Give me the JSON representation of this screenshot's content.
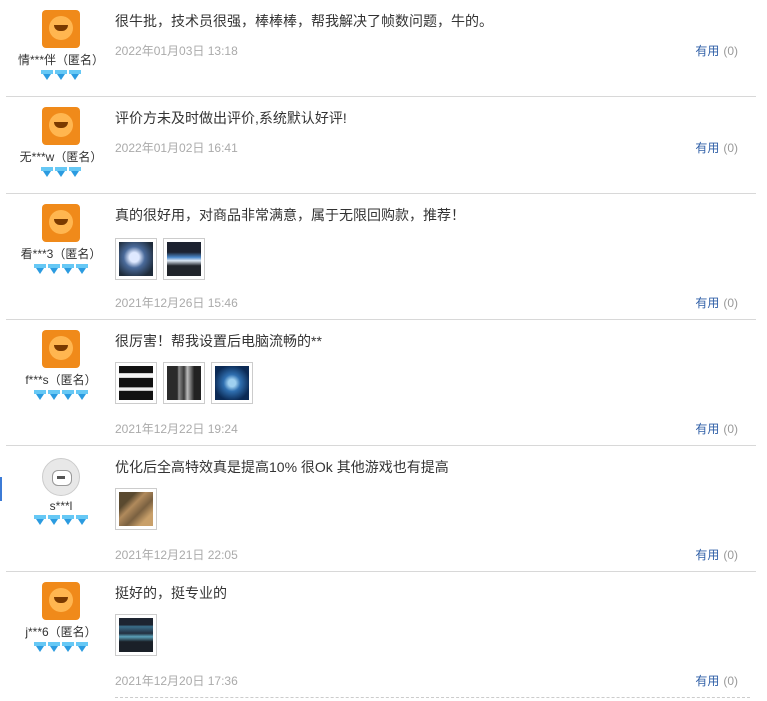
{
  "reviews": [
    {
      "user": "情***伴（匿名）",
      "avatar": "orange-mascot-avatar",
      "level_gems": 3,
      "text": "很牛批，技术员很强，棒棒棒，帮我解决了帧数问题，牛的。",
      "date": "2022年01月03日 13:18",
      "useful_label": "有用",
      "useful_count": "(0)",
      "images": []
    },
    {
      "user": "无***w（匿名）",
      "avatar": "orange-mascot-avatar",
      "level_gems": 3,
      "text": "评价方未及时做出评价,系统默认好评!",
      "date": "2022年01月02日 16:41",
      "useful_label": "有用",
      "useful_count": "(0)",
      "images": []
    },
    {
      "user": "看***3（匿名）",
      "avatar": "orange-mascot-avatar",
      "level_gems": 4,
      "text": "真的很好用，对商品非常满意，属于无限回购款，推荐！",
      "date": "2021年12月26日 15:46",
      "useful_label": "有用",
      "useful_count": "(0)",
      "images": [
        "monitor-photo-thumbnail",
        "screen-photo-thumbnail"
      ]
    },
    {
      "user": "f***s（匿名）",
      "avatar": "orange-mascot-avatar",
      "level_gems": 4,
      "text": "很厉害！帮我设置后电脑流畅的**",
      "date": "2021年12月22日 19:24",
      "useful_label": "有用",
      "useful_count": "(0)",
      "images": [
        "dark-screen-thumbnail",
        "pc-case-thumbnail",
        "desktop-screen-thumbnail"
      ]
    },
    {
      "user": "s***l",
      "avatar": "robot-avatar",
      "level_gems": 4,
      "text": "优化后全高特效真是提高10% 很Ok 其他游戏也有提高",
      "date": "2021年12月21日 22:05",
      "useful_label": "有用",
      "useful_count": "(0)",
      "images": [
        "hand-photo-thumbnail"
      ]
    },
    {
      "user": "j***6（匿名）",
      "avatar": "orange-mascot-avatar",
      "level_gems": 4,
      "text": "挺好的，挺专业的",
      "date": "2021年12月20日 17:36",
      "useful_label": "有用",
      "useful_count": "(0)",
      "images": [
        "software-screen-thumbnail"
      ]
    }
  ],
  "colors": {
    "link": "#2f5fa7",
    "date": "#aaaaaa",
    "gem": "#2b9be0",
    "avatar": "#f08a1a"
  }
}
